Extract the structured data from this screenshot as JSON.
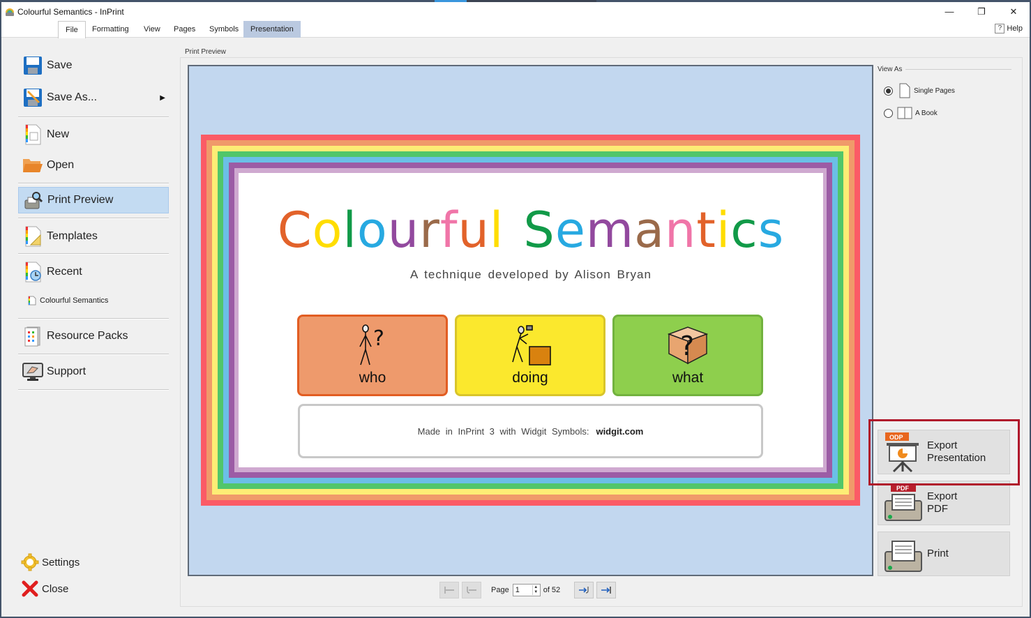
{
  "window": {
    "title": "Colourful Semantics - InPrint",
    "controls": {
      "minimize": "—",
      "restore": "❐",
      "close": "✕"
    }
  },
  "ribbon": {
    "tabs": [
      {
        "label": "File",
        "active": true
      },
      {
        "label": "Formatting"
      },
      {
        "label": "View"
      },
      {
        "label": "Pages"
      },
      {
        "label": "Symbols"
      },
      {
        "label": "Presentation",
        "highlighted": true
      }
    ],
    "help_label": "Help",
    "help_icon": "?"
  },
  "sidebar": {
    "items": [
      {
        "label": "Save",
        "icon": "save-icon"
      },
      {
        "label": "Save As...",
        "icon": "save-as-icon",
        "submenu_arrow": "▶"
      },
      {
        "label": "New",
        "icon": "new-document-icon"
      },
      {
        "label": "Open",
        "icon": "folder-open-icon"
      },
      {
        "label": "Print Preview",
        "icon": "print-preview-icon",
        "selected": true
      },
      {
        "label": "Templates",
        "icon": "templates-icon"
      },
      {
        "label": "Recent",
        "icon": "recent-icon"
      },
      {
        "label": "Resource Packs",
        "icon": "resource-packs-icon"
      },
      {
        "label": "Support",
        "icon": "support-icon"
      }
    ],
    "recent_files": [
      "Colourful Semantics"
    ],
    "bottom": [
      {
        "label": "Settings",
        "icon": "gear-icon"
      },
      {
        "label": "Close",
        "icon": "close-x-icon"
      }
    ]
  },
  "print_preview": {
    "group_label": "Print Preview",
    "page": {
      "title_letters": [
        {
          "ch": "C",
          "color": "#e2622a"
        },
        {
          "ch": "o",
          "color": "#ffdd00"
        },
        {
          "ch": "l",
          "color": "#119a48"
        },
        {
          "ch": "o",
          "color": "#27a9e1"
        },
        {
          "ch": "u",
          "color": "#92499e"
        },
        {
          "ch": "r",
          "color": "#9a6a4a"
        },
        {
          "ch": "f",
          "color": "#f075a8"
        },
        {
          "ch": "u",
          "color": "#e2622a"
        },
        {
          "ch": "l",
          "color": "#ffdd00"
        },
        {
          "ch": " ",
          "color": "#ffffff"
        },
        {
          "ch": "S",
          "color": "#119a48"
        },
        {
          "ch": "e",
          "color": "#27a9e1"
        },
        {
          "ch": "m",
          "color": "#92499e"
        },
        {
          "ch": "a",
          "color": "#9a6a4a"
        },
        {
          "ch": "n",
          "color": "#f075a8"
        },
        {
          "ch": "t",
          "color": "#e2622a"
        },
        {
          "ch": "i",
          "color": "#ffdd00"
        },
        {
          "ch": "c",
          "color": "#119a48"
        },
        {
          "ch": "s",
          "color": "#27a9e1"
        }
      ],
      "subtitle": "A technique developed by Alison Bryan",
      "cards": [
        {
          "word": "who",
          "bg": "#ee9a6c",
          "border": "#e25d22",
          "symbol": "person-question-symbol"
        },
        {
          "word": "doing",
          "bg": "#fbe82d",
          "border": "#d9c52a",
          "symbol": "person-hammering-symbol"
        },
        {
          "word": "what",
          "bg": "#8ecf4d",
          "border": "#72b23e",
          "symbol": "box-question-symbol"
        }
      ],
      "credit_text": "Made in InPrint 3 with Widgit Symbols:",
      "credit_link": "widgit.com",
      "rainbow_colors": [
        "#fb5b66",
        "#f09a6a",
        "#fded75",
        "#51c66a",
        "#6bbfe6",
        "#9c5ca5",
        "#cfa9d0"
      ]
    },
    "pager": {
      "page_label": "Page",
      "page_value": "1",
      "of_label": "of 52",
      "buttons": [
        "first-page",
        "previous-page",
        "next-page",
        "last-page"
      ]
    }
  },
  "view_as": {
    "title": "View As",
    "options": [
      {
        "label": "Single Pages",
        "checked": true,
        "icon": "single-page-icon"
      },
      {
        "label": "A Book",
        "checked": false,
        "icon": "book-icon"
      }
    ]
  },
  "actions": [
    {
      "label_line1": "Export",
      "label_line2": "Presentation",
      "badge": "ODP",
      "badge_color": "#e8661e",
      "highlighted": true
    },
    {
      "label_line1": "Export",
      "label_line2": "PDF",
      "badge": "PDF",
      "badge_color": "#b8202c"
    },
    {
      "label_line1": "Print",
      "label_line2": ""
    }
  ],
  "colors": {
    "preview_bg": "#c2d7ef",
    "selected_menu": "#c3dbf2",
    "highlight_frame": "#b0182b",
    "presentation_tab": "#bac9e0"
  }
}
